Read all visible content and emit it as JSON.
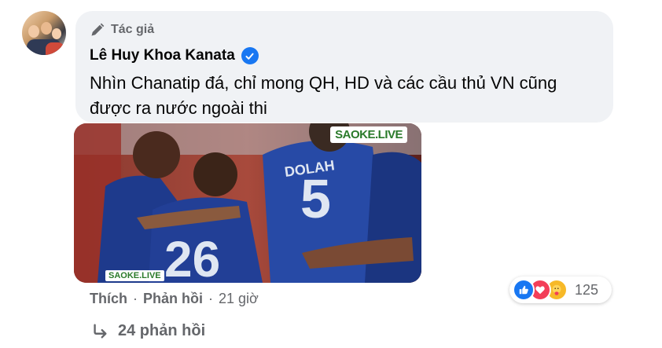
{
  "comment": {
    "author_badge": "Tác giả",
    "author_name": "Lê Huy Khoa Kanata",
    "text": "Nhìn Chanatip đá, chỉ mong QH, HD và các cầu thủ VN cũng được ra nước ngoài thi"
  },
  "media": {
    "watermark_top": "SAOKE.LIVE",
    "watermark_bottom": "SAOKE.LIVE",
    "jersey_name": "DOLAH",
    "jersey_number_1": "5",
    "jersey_number_2": "26"
  },
  "actions": {
    "like_label": "Thích",
    "separator": "·",
    "reply_label": "Phản hồi",
    "timestamp": "21 giờ"
  },
  "reactions": {
    "types": [
      "like-icon",
      "love-icon",
      "care-icon"
    ],
    "count": "125"
  },
  "replies": {
    "label": "24 phản hồi"
  },
  "colors": {
    "bubble_bg": "#f0f2f5",
    "secondary_text": "#65676b",
    "verified_blue": "#1877f2"
  }
}
